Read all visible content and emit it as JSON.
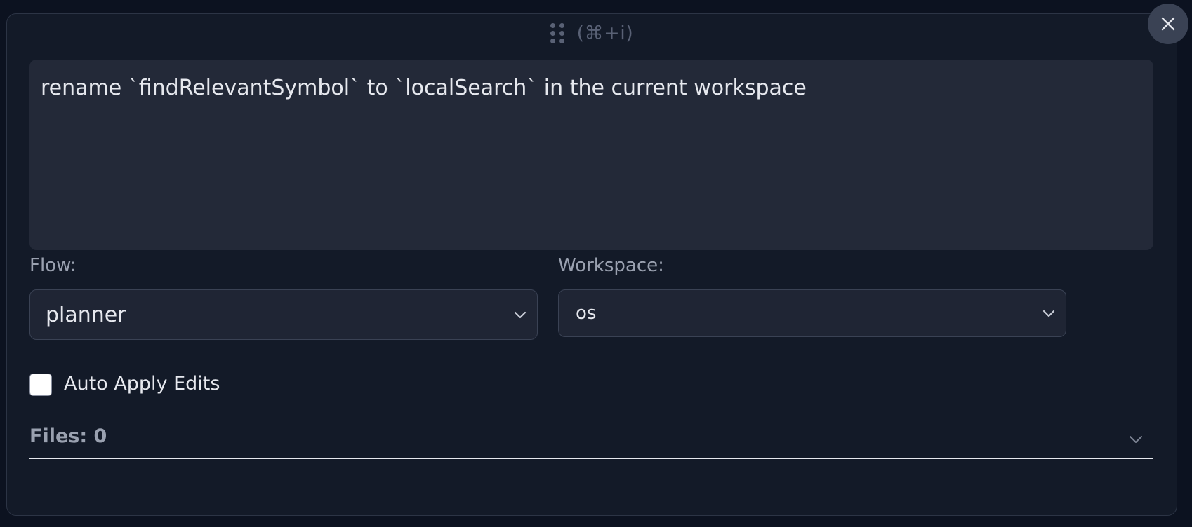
{
  "header": {
    "shortcut": "(⌘+i)"
  },
  "prompt": {
    "value": "rename `findRelevantSymbol` to `localSearch` in the current workspace"
  },
  "flow": {
    "label": "Flow:",
    "selected": "planner"
  },
  "workspace": {
    "label": "Workspace:",
    "selected": "os"
  },
  "auto_apply": {
    "label": "Auto Apply Edits",
    "checked": false
  },
  "files": {
    "label": "Files: 0"
  },
  "colors": {
    "background": "#0c1220",
    "panel": "#131a28",
    "input": "#232938",
    "text": "#e6e8ee",
    "muted": "#9aa1b0"
  },
  "icons": {
    "drag": "drag-handle-icon",
    "close": "close-icon",
    "dropdown": "chevron-down-icon"
  }
}
